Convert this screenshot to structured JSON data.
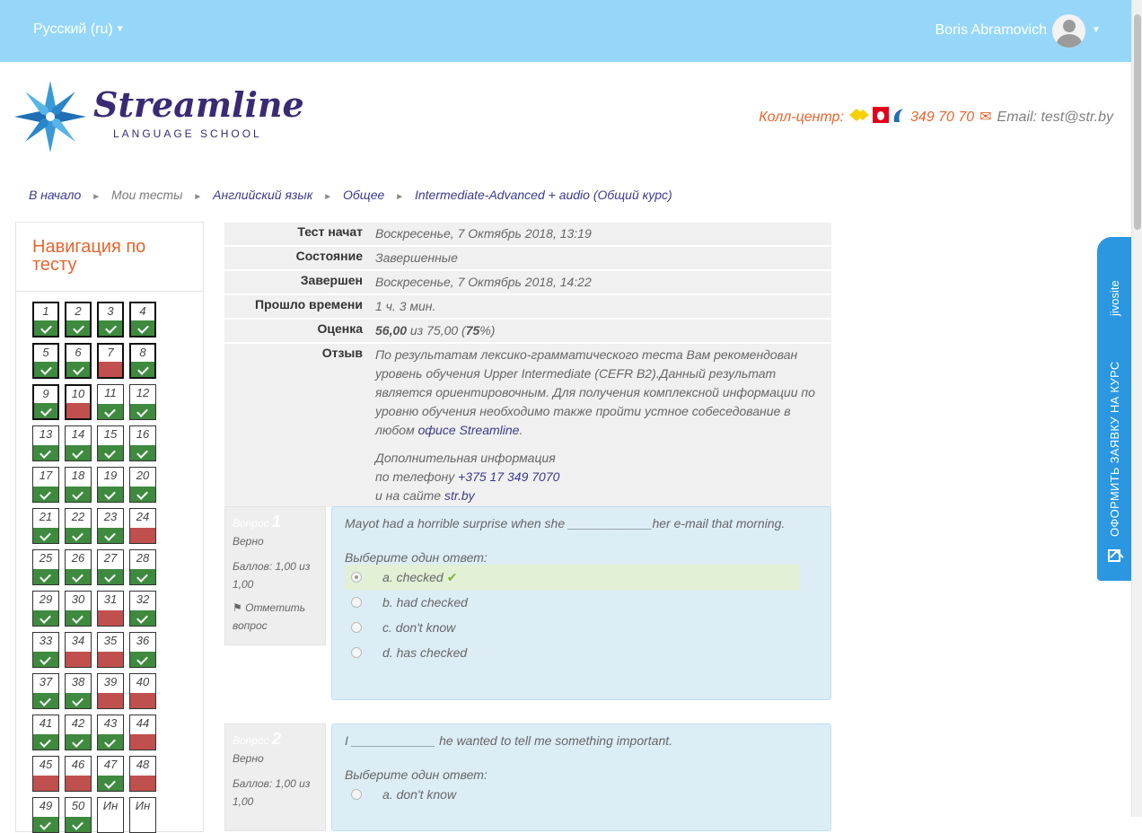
{
  "topbar": {
    "language": "Русский (ru)",
    "user_name": "Boris Abramovich"
  },
  "logo": {
    "brand": "Streamline",
    "subtitle": "LANGUAGE SCHOOL"
  },
  "contact": {
    "call_center_label": "Колл-центр:",
    "phone": "349 70 70",
    "email_label": "Email: test@str.by"
  },
  "breadcrumb": [
    {
      "label": "В начало",
      "link": true
    },
    {
      "label": "Мои тесты",
      "link": false
    },
    {
      "label": "Английский язык",
      "link": true
    },
    {
      "label": "Общее",
      "link": true
    },
    {
      "label": "Intermediate-Advanced + audio (Общий курс)",
      "link": true
    }
  ],
  "navigation": {
    "title": "Навигация по тесту",
    "questions": [
      {
        "n": "1",
        "s": "ok",
        "flag": true
      },
      {
        "n": "2",
        "s": "ok",
        "flag": true
      },
      {
        "n": "3",
        "s": "ok",
        "flag": true
      },
      {
        "n": "4",
        "s": "ok",
        "flag": true
      },
      {
        "n": "5",
        "s": "ok",
        "flag": true
      },
      {
        "n": "6",
        "s": "ok",
        "flag": true
      },
      {
        "n": "7",
        "s": "bad",
        "flag": true
      },
      {
        "n": "8",
        "s": "ok",
        "flag": true
      },
      {
        "n": "9",
        "s": "ok",
        "flag": true
      },
      {
        "n": "10",
        "s": "bad",
        "flag": true
      },
      {
        "n": "11",
        "s": "ok",
        "flag": false
      },
      {
        "n": "12",
        "s": "ok",
        "flag": false
      },
      {
        "n": "13",
        "s": "ok",
        "flag": false
      },
      {
        "n": "14",
        "s": "ok",
        "flag": false
      },
      {
        "n": "15",
        "s": "ok",
        "flag": false
      },
      {
        "n": "16",
        "s": "ok",
        "flag": false
      },
      {
        "n": "17",
        "s": "ok",
        "flag": false
      },
      {
        "n": "18",
        "s": "ok",
        "flag": false
      },
      {
        "n": "19",
        "s": "ok",
        "flag": false
      },
      {
        "n": "20",
        "s": "ok",
        "flag": false
      },
      {
        "n": "21",
        "s": "ok",
        "flag": false
      },
      {
        "n": "22",
        "s": "ok",
        "flag": false
      },
      {
        "n": "23",
        "s": "ok",
        "flag": false
      },
      {
        "n": "24",
        "s": "bad",
        "flag": false
      },
      {
        "n": "25",
        "s": "ok",
        "flag": false
      },
      {
        "n": "26",
        "s": "ok",
        "flag": false
      },
      {
        "n": "27",
        "s": "ok",
        "flag": false
      },
      {
        "n": "28",
        "s": "ok",
        "flag": false
      },
      {
        "n": "29",
        "s": "ok",
        "flag": false
      },
      {
        "n": "30",
        "s": "ok",
        "flag": false
      },
      {
        "n": "31",
        "s": "bad",
        "flag": false
      },
      {
        "n": "32",
        "s": "ok",
        "flag": false
      },
      {
        "n": "33",
        "s": "ok",
        "flag": false
      },
      {
        "n": "34",
        "s": "bad",
        "flag": false
      },
      {
        "n": "35",
        "s": "bad",
        "flag": false
      },
      {
        "n": "36",
        "s": "ok",
        "flag": false
      },
      {
        "n": "37",
        "s": "ok",
        "flag": false
      },
      {
        "n": "38",
        "s": "ok",
        "flag": false
      },
      {
        "n": "39",
        "s": "bad",
        "flag": false
      },
      {
        "n": "40",
        "s": "bad",
        "flag": false
      },
      {
        "n": "41",
        "s": "ok",
        "flag": false
      },
      {
        "n": "42",
        "s": "ok",
        "flag": false
      },
      {
        "n": "43",
        "s": "ok",
        "flag": false
      },
      {
        "n": "44",
        "s": "bad",
        "flag": false
      },
      {
        "n": "45",
        "s": "bad",
        "flag": false
      },
      {
        "n": "46",
        "s": "bad",
        "flag": false
      },
      {
        "n": "47",
        "s": "ok",
        "flag": false
      },
      {
        "n": "48",
        "s": "bad",
        "flag": false
      },
      {
        "n": "49",
        "s": "ok",
        "flag": false
      },
      {
        "n": "50",
        "s": "ok",
        "flag": false
      },
      {
        "n": "Ин",
        "s": "none",
        "flag": false
      },
      {
        "n": "Ин",
        "s": "none",
        "flag": false
      }
    ]
  },
  "summary": {
    "started_label": "Тест начат",
    "started": "Воскресенье, 7 Октябрь 2018, 13:19",
    "state_label": "Состояние",
    "state": "Завершенные",
    "finished_label": "Завершен",
    "finished": "Воскресенье, 7 Октябрь 2018, 14:22",
    "elapsed_label": "Прошло времени",
    "elapsed": "1 ч. 3 мин.",
    "grade_label": "Оценка",
    "grade_value": "56,00",
    "grade_of": " из 75,00 (",
    "grade_percent": "75",
    "grade_end": "%)",
    "feedback_label": "Отзыв",
    "feedback_text": "По результатам лексико-грамматического теста Вам рекомендован уровень обучения Upper Intermediate (CEFR B2).Данный результат является ориентировочным. Для получения комплексной информации по уровню обучения необходимо также пройти устное собеседование в любом ",
    "feedback_link": "офисе Streamline",
    "feedback_end": ".",
    "extra_line1": "Дополнительная информация",
    "extra_line2": "по телефону ",
    "extra_phone": "+375 17 349 7070",
    "extra_line3": "и на сайте ",
    "extra_site": "str.by"
  },
  "questions": [
    {
      "label": "Вопрос ",
      "number": "1",
      "status": "Верно",
      "marks": "Баллов: 1,00 из 1,00",
      "flag": "Отметить вопрос",
      "text": "Mayot had a horrible surprise when she ____________her e-mail that morning.",
      "prompt": "Выберите один ответ:",
      "answers": [
        "a. checked",
        "b. had checked",
        "c. don't know",
        "d. has checked"
      ]
    },
    {
      "label": "Вопрос ",
      "number": "2",
      "status": "Верно",
      "marks": "Баллов: 1,00 из 1,00",
      "text": "I ____________ he wanted to tell me something important.",
      "prompt": "Выберите один ответ:",
      "answers": [
        "a. don't know"
      ]
    }
  ],
  "jivo": {
    "brand": "jivosite",
    "cta": "ОФОРМИТЬ ЗАЯВКУ НА КУРС"
  },
  "colors": {
    "topbar": "#96d7f9",
    "accent": "#e8652e",
    "correct": "#3e8a3e",
    "incorrect": "#c0504d",
    "jivo": "#2a97e0"
  }
}
